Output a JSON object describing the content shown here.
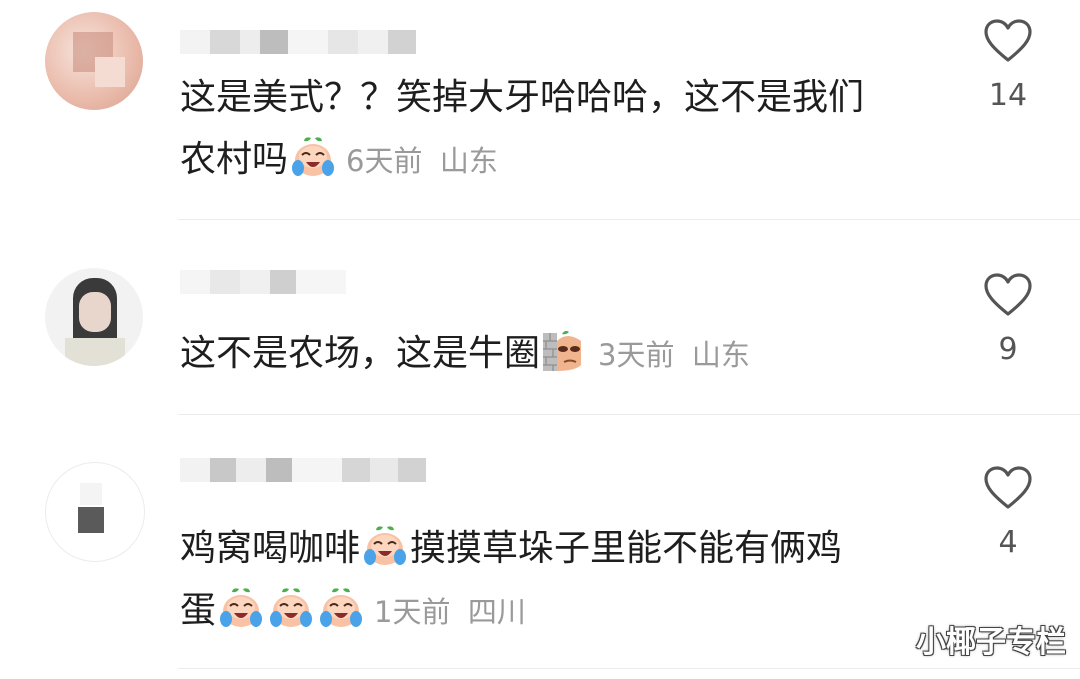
{
  "comments": [
    {
      "line1": "这是美式？？笑掉大牙哈哈哈，这不是我们",
      "line2": "农村吗",
      "time": "6天前",
      "location": "山东",
      "likes": "14"
    },
    {
      "line1": "这不是农场，这是牛圈",
      "time": "3天前",
      "location": "山东",
      "likes": "9"
    },
    {
      "line1_a": "鸡窝喝咖啡",
      "line1_b": "摸摸草垛子里能不能有俩鸡",
      "line2": "蛋",
      "time": "1天前",
      "location": "四川",
      "likes": "4"
    }
  ],
  "watermark": "小椰子专栏",
  "icons": {
    "like": "heart-outline-icon",
    "crying_emoji": "crying-laugh-peach-emoji-icon",
    "peek_emoji": "wall-peek-emoji-icon"
  },
  "colors": {
    "text": "#1e1e1e",
    "meta": "#9a9a9a",
    "divider": "#ececec",
    "heart_stroke": "#555555"
  }
}
